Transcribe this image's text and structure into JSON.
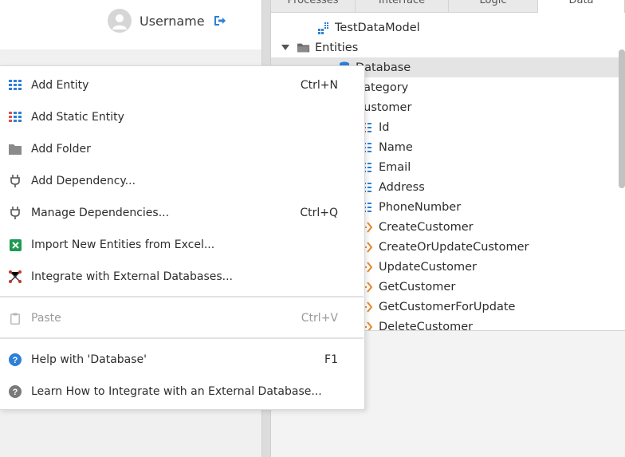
{
  "header": {
    "username": "Username"
  },
  "tabs": [
    {
      "label": "Processes"
    },
    {
      "label": "Interface"
    },
    {
      "label": "Logic"
    },
    {
      "label": "Data"
    }
  ],
  "tree": {
    "items": [
      {
        "label": "TestDataModel",
        "icon": "data-model-icon"
      },
      {
        "label": "Entities",
        "icon": "folder-icon"
      },
      {
        "label": "Database",
        "icon": "database-icon"
      },
      {
        "label": "Category",
        "icon": "entity-icon"
      },
      {
        "label": "Customer",
        "icon": "entity-icon"
      },
      {
        "label": "Id",
        "icon": "attribute-icon"
      },
      {
        "label": "Name",
        "icon": "attribute-icon"
      },
      {
        "label": "Email",
        "icon": "attribute-icon"
      },
      {
        "label": "Address",
        "icon": "attribute-icon"
      },
      {
        "label": "PhoneNumber",
        "icon": "attribute-icon"
      },
      {
        "label": "CreateCustomer",
        "icon": "action-icon"
      },
      {
        "label": "CreateOrUpdateCustomer",
        "icon": "action-icon"
      },
      {
        "label": "UpdateCustomer",
        "icon": "action-icon"
      },
      {
        "label": "GetCustomer",
        "icon": "action-icon"
      },
      {
        "label": "GetCustomerForUpdate",
        "icon": "action-icon"
      },
      {
        "label": "DeleteCustomer",
        "icon": "action-icon"
      }
    ]
  },
  "menu": {
    "items": [
      {
        "label": "Add Entity",
        "shortcut": "Ctrl+N",
        "icon": "entity-table-icon"
      },
      {
        "label": "Add Static Entity",
        "shortcut": "",
        "icon": "static-entity-icon"
      },
      {
        "label": "Add Folder",
        "shortcut": "",
        "icon": "folder-icon"
      },
      {
        "label": "Add Dependency...",
        "shortcut": "",
        "icon": "plug-icon"
      },
      {
        "label": "Manage Dependencies...",
        "shortcut": "Ctrl+Q",
        "icon": "plug-icon"
      },
      {
        "label": "Import New Entities from Excel...",
        "shortcut": "",
        "icon": "excel-icon"
      },
      {
        "label": "Integrate with External Databases...",
        "shortcut": "",
        "icon": "network-icon"
      },
      {
        "label": "Paste",
        "shortcut": "Ctrl+V",
        "icon": "clipboard-icon",
        "disabled": true
      },
      {
        "label": "Help with 'Database'",
        "shortcut": "F1",
        "icon": "help-icon"
      },
      {
        "label": "Learn How to Integrate with an External Database...",
        "shortcut": "",
        "icon": "question-icon"
      }
    ]
  },
  "colors": {
    "accent_blue": "#2e7fd6",
    "static_red": "#d9534f",
    "action_orange": "#e8892b",
    "excel_green": "#1e9a52",
    "network_red": "#c0392b"
  }
}
